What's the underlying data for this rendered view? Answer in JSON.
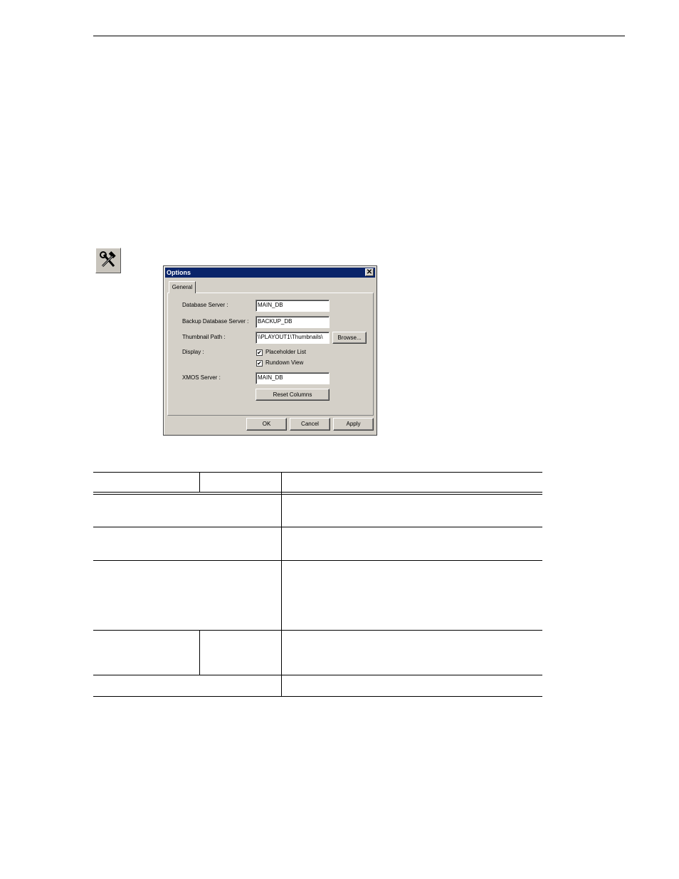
{
  "toolbar_icon": {
    "name": "tools-icon",
    "glyph": "hammer and wrench"
  },
  "dialog": {
    "title": "Options",
    "close_label": "✕",
    "tab_label": "General",
    "fields": {
      "database_server_label": "Database Server :",
      "database_server_value": "MAIN_DB",
      "backup_server_label": "Backup Database Server :",
      "backup_server_value": "BACKUP_DB",
      "thumbnail_path_label": "Thumbnail Path :",
      "thumbnail_path_value": "\\\\PLAYOUT1\\Thumbnails\\",
      "browse_label": "Browse...",
      "display_label": "Display :",
      "placeholder_list_label": "Placeholder List",
      "rundown_view_label": "Rundown View",
      "xmos_server_label": "XMOS Server :",
      "xmos_server_value": "MAIN_DB",
      "reset_columns_label": "Reset Columns"
    },
    "checkboxes": {
      "placeholder_list_checked": true,
      "rundown_view_checked": true
    },
    "buttons": {
      "ok": "OK",
      "cancel": "Cancel",
      "apply": "Apply"
    }
  }
}
